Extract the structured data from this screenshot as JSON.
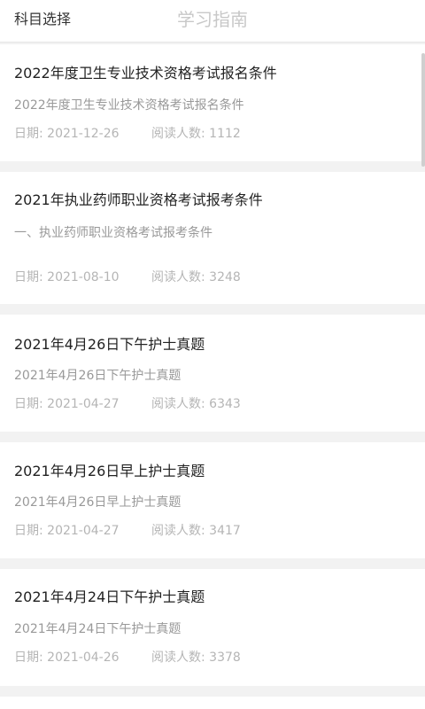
{
  "header": {
    "left_label": "科目选择",
    "title": "学习指南"
  },
  "articles": [
    {
      "title": "2022年度卫生专业技术资格考试报名条件",
      "summary": "2022年度卫生专业技术资格考试报名条件",
      "date_label": "日期:",
      "date": "2021-12-26",
      "readers_label": "阅读人数:",
      "readers": "1112"
    },
    {
      "title": "2021年执业药师职业资格考试报考条件",
      "summary": "一、执业药师职业资格考试报考条件",
      "date_label": "日期:",
      "date": "2021-08-10",
      "readers_label": "阅读人数:",
      "readers": "3248"
    },
    {
      "title": "2021年4月26日下午护士真题",
      "summary": "2021年4月26日下午护士真题",
      "date_label": "日期:",
      "date": "2021-04-27",
      "readers_label": "阅读人数:",
      "readers": "6343"
    },
    {
      "title": "2021年4月26日早上护士真题",
      "summary": "2021年4月26日早上护士真题",
      "date_label": "日期:",
      "date": "2021-04-27",
      "readers_label": "阅读人数:",
      "readers": "3417"
    },
    {
      "title": "2021年4月24日下午护士真题",
      "summary": "2021年4月24日下午护士真题",
      "date_label": "日期:",
      "date": "2021-04-26",
      "readers_label": "阅读人数:",
      "readers": "3378"
    }
  ]
}
